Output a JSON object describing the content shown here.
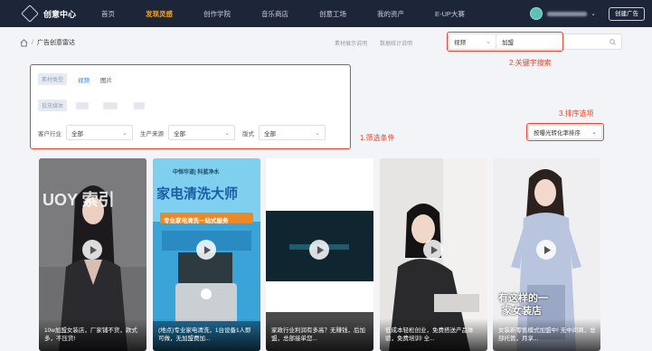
{
  "topnav": {
    "brand": "创意中心",
    "items": [
      {
        "label": "首页",
        "active": false
      },
      {
        "label": "发现灵感",
        "active": true
      },
      {
        "label": "创作学院",
        "active": false
      },
      {
        "label": "音乐商店",
        "active": false
      },
      {
        "label": "创意工场",
        "active": false
      },
      {
        "label": "我的资产",
        "active": false
      },
      {
        "label": "E-UP大赛",
        "active": false
      }
    ],
    "create_ad": "创建广告"
  },
  "breadcrumb": {
    "sep": "/",
    "title": "广告创意雷达"
  },
  "info_links": [
    "素材展示说明",
    "数据统计说明"
  ],
  "search": {
    "type": "视频",
    "keyword": "加盟"
  },
  "annotations": {
    "keyword": "2.关键字搜索",
    "sort": "3.排序选项",
    "filter": "1.筛选条件"
  },
  "filters": {
    "material_type_label": "素材类型",
    "material_types": [
      {
        "label": "视频",
        "active": true
      },
      {
        "label": "图片",
        "active": false
      }
    ],
    "media_label": "投放媒体",
    "industry_label": "客户行业",
    "industry_value": "全部",
    "source_label": "生产来源",
    "source_value": "全部",
    "layout_label": "版式",
    "layout_value": "全部"
  },
  "sort": {
    "value": "按曝光转化率排序"
  },
  "cards": [
    {
      "caption": "10w加盟女装店，厂家铺不货，款式多，不压货!",
      "overlay": "UOY 索引"
    },
    {
      "caption": "(地点)专业家电清洗，1台设备1人即可做，无加盟费加...",
      "overlay_top": "中恒华道| 科蓝净水",
      "overlay_title": "家电清洗大师",
      "overlay_sub": "专业家电清洗一站式服务"
    },
    {
      "caption": "家政行业利润有多高？无赚钱，后加盟，总部接单您...",
      "overlay": ""
    },
    {
      "caption": "低成本轻松创业，免费搭送产品体验，免费培训! 全...",
      "overlay": ""
    },
    {
      "caption": "女装新零售模式加盟中! 无中间商，总部托管，月享...",
      "overlay_line1": "有这样的一",
      "overlay_line2": "家女装店"
    }
  ],
  "colors": {
    "nav_bg": "#1d2538",
    "nav_active": "#f5a623",
    "accent_blue": "#2a7ef5",
    "annotation_red": "#e8452c"
  }
}
